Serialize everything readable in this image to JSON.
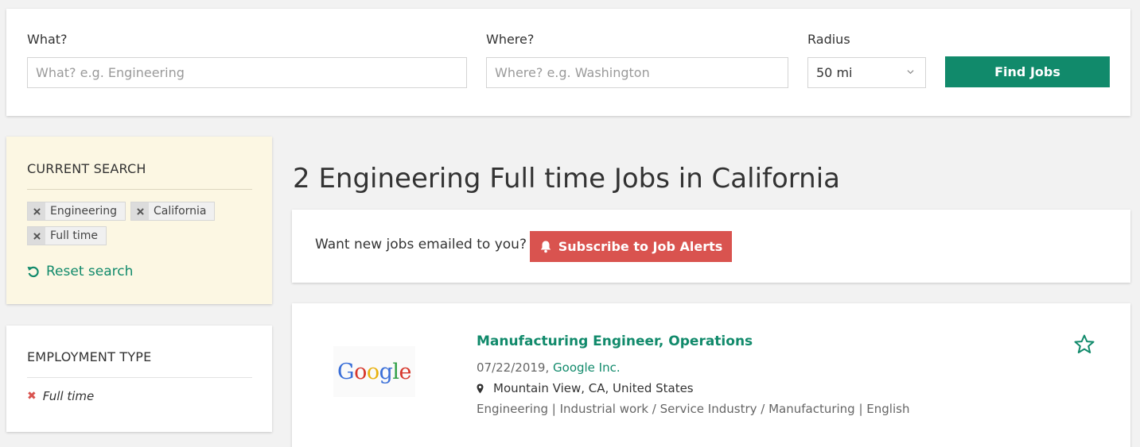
{
  "search": {
    "what_label": "What?",
    "what_placeholder": "What? e.g. Engineering",
    "what_value": "",
    "where_label": "Where?",
    "where_placeholder": "Where? e.g. Washington",
    "where_value": "",
    "radius_label": "Radius",
    "radius_value": "50 mi",
    "find_label": "Find Jobs"
  },
  "current_search": {
    "heading": "CURRENT SEARCH",
    "tags": [
      "Engineering",
      "California",
      "Full time"
    ],
    "reset_label": "Reset search"
  },
  "employment_type": {
    "heading": "EMPLOYMENT TYPE",
    "items": [
      "Full time"
    ]
  },
  "results": {
    "title": "2 Engineering Full time Jobs in California",
    "alert_text": "Want new jobs emailed to you?",
    "subscribe_label": "Subscribe to Job Alerts"
  },
  "jobs": [
    {
      "logo_text": "Google",
      "title": "Manufacturing Engineer, Operations",
      "date": "07/22/2019,",
      "company": "Google Inc.",
      "location": "Mountain View, CA, United States",
      "categories": "Engineering | Industrial work / Service Industry / Manufacturing | English"
    }
  ],
  "colors": {
    "accent": "#118a6b",
    "alert": "#d9534f",
    "panel_highlight": "#fcf7e3",
    "background": "#f2f2f2"
  },
  "icons": [
    "chevron-down-icon",
    "remove-tag-icon",
    "reset-icon",
    "remove-filter-icon",
    "bell-icon",
    "map-marker-icon",
    "star-outline-icon"
  ]
}
